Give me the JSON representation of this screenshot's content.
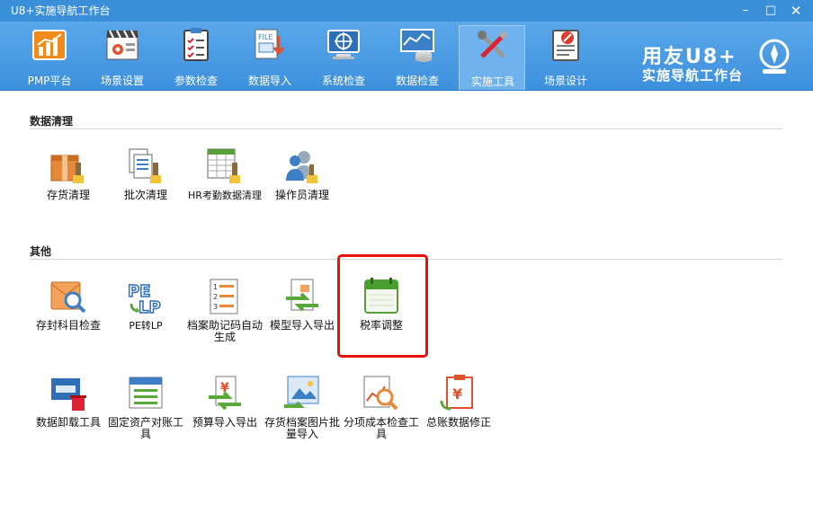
{
  "window": {
    "title": "U8+实施导航工作台",
    "controls": [
      "minimize-icon",
      "maximize-icon",
      "close-icon"
    ]
  },
  "toolbar": {
    "items": [
      {
        "label": "PMP平台",
        "icon": "pmp-chart-icon"
      },
      {
        "label": "场景设置",
        "icon": "scene-settings-icon"
      },
      {
        "label": "参数检查",
        "icon": "param-check-icon"
      },
      {
        "label": "数据导入",
        "icon": "data-import-icon"
      },
      {
        "label": "系统检查",
        "icon": "system-check-icon"
      },
      {
        "label": "数据检查",
        "icon": "data-check-icon"
      },
      {
        "label": "实施工具",
        "icon": "impl-tools-icon",
        "active": true
      },
      {
        "label": "场景设计",
        "icon": "scene-design-icon"
      }
    ]
  },
  "brand": {
    "line1": "用友U8+",
    "line2": "实施导航工作台",
    "icon": "compass-icon"
  },
  "sections": [
    {
      "title": "数据清理",
      "tools": [
        {
          "label": "存货清理",
          "icon": "inventory-clean-icon"
        },
        {
          "label": "批次清理",
          "icon": "batch-clean-icon"
        },
        {
          "label": "HR考勤数据清理",
          "icon": "hr-attendance-clean-icon"
        },
        {
          "label": "操作员清理",
          "icon": "operator-clean-icon"
        }
      ]
    },
    {
      "title": "其他",
      "tools": [
        {
          "label": "存封科目检查",
          "icon": "account-check-icon"
        },
        {
          "label": "PE转LP",
          "icon": "pe-to-lp-icon"
        },
        {
          "label": "档案助记码自动生成",
          "icon": "mnemonic-code-icon"
        },
        {
          "label": "模型导入导出",
          "icon": "model-import-export-icon"
        },
        {
          "label": "税率调整",
          "icon": "tax-rate-adjust-icon",
          "highlighted": true
        },
        {
          "label": "数据卸载工具",
          "icon": "data-unload-icon"
        },
        {
          "label": "固定资产对账工具",
          "icon": "fixed-asset-reconcile-icon"
        },
        {
          "label": "预算导入导出",
          "icon": "budget-import-export-icon"
        },
        {
          "label": "存货档案图片批量导入",
          "icon": "inventory-image-import-icon"
        },
        {
          "label": "分项成本检查工具",
          "icon": "cost-check-icon"
        },
        {
          "label": "总账数据修正",
          "icon": "ledger-fix-icon"
        }
      ]
    }
  ],
  "colors": {
    "titlebar": "#3a8fd8",
    "toolbar": "#4a9be4",
    "highlight": "#e8120c"
  }
}
